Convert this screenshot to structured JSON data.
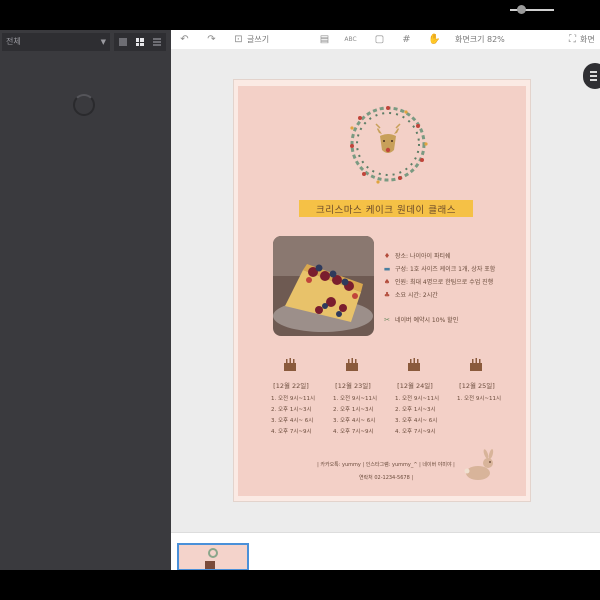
{
  "left_panel": {
    "filter_select": {
      "value": "전체"
    },
    "view_modes": [
      "single",
      "grid",
      "list"
    ],
    "selected_view": "grid"
  },
  "toolbar": {
    "undo_icon": "undo-icon",
    "redo_icon": "redo-icon",
    "text_label": "글쓰기",
    "zoom_label": "화면크기 82%",
    "fit_label": "화면"
  },
  "poster": {
    "title": "크리스마스 케이크 원데이 클래스",
    "info": [
      {
        "icon": "pin-icon",
        "text": "장소: 나이아이 파티쉐"
      },
      {
        "icon": "box-icon",
        "text": "구성: 1호 사이즈 케이크 1개, 상자 포함"
      },
      {
        "icon": "people-icon",
        "text": "인원: 최대 4명으로 한팀으로 수업 진행"
      },
      {
        "icon": "clock-icon",
        "text": "소요 시간: 2시간"
      }
    ],
    "discount": "네이버 예약시 10% 할인",
    "days": [
      {
        "date": "[12월 22일]",
        "slots": [
          "1. 오전 9시~11시",
          "2. 오후 1시~3시",
          "3. 오후 4시~ 6시",
          "4. 오후 7시~9시"
        ]
      },
      {
        "date": "[12월 23일]",
        "slots": [
          "1. 오전 9시~11시",
          "2. 오후 1시~3시",
          "3. 오후 4시~ 6시",
          "4. 오후 7시~9시"
        ]
      },
      {
        "date": "[12월 24일]",
        "slots": [
          "1. 오전 9시~11시",
          "2. 오후 1시~3시",
          "3. 오후 4시~ 6시",
          "4. 오후 7시~9시"
        ]
      },
      {
        "date": "[12월 25일]",
        "slots": [
          "1. 오전 9시~11시"
        ]
      }
    ],
    "footer_line1": "| 카카오톡: yummy | 인스타그램: yummy_^ | 네이버 야미야 |",
    "footer_line2": "연락처 02-1234-5678 |"
  },
  "colors": {
    "poster_bg": "#f3d0c7",
    "title_bar": "#f5c146",
    "text": "#6a4b3b"
  }
}
